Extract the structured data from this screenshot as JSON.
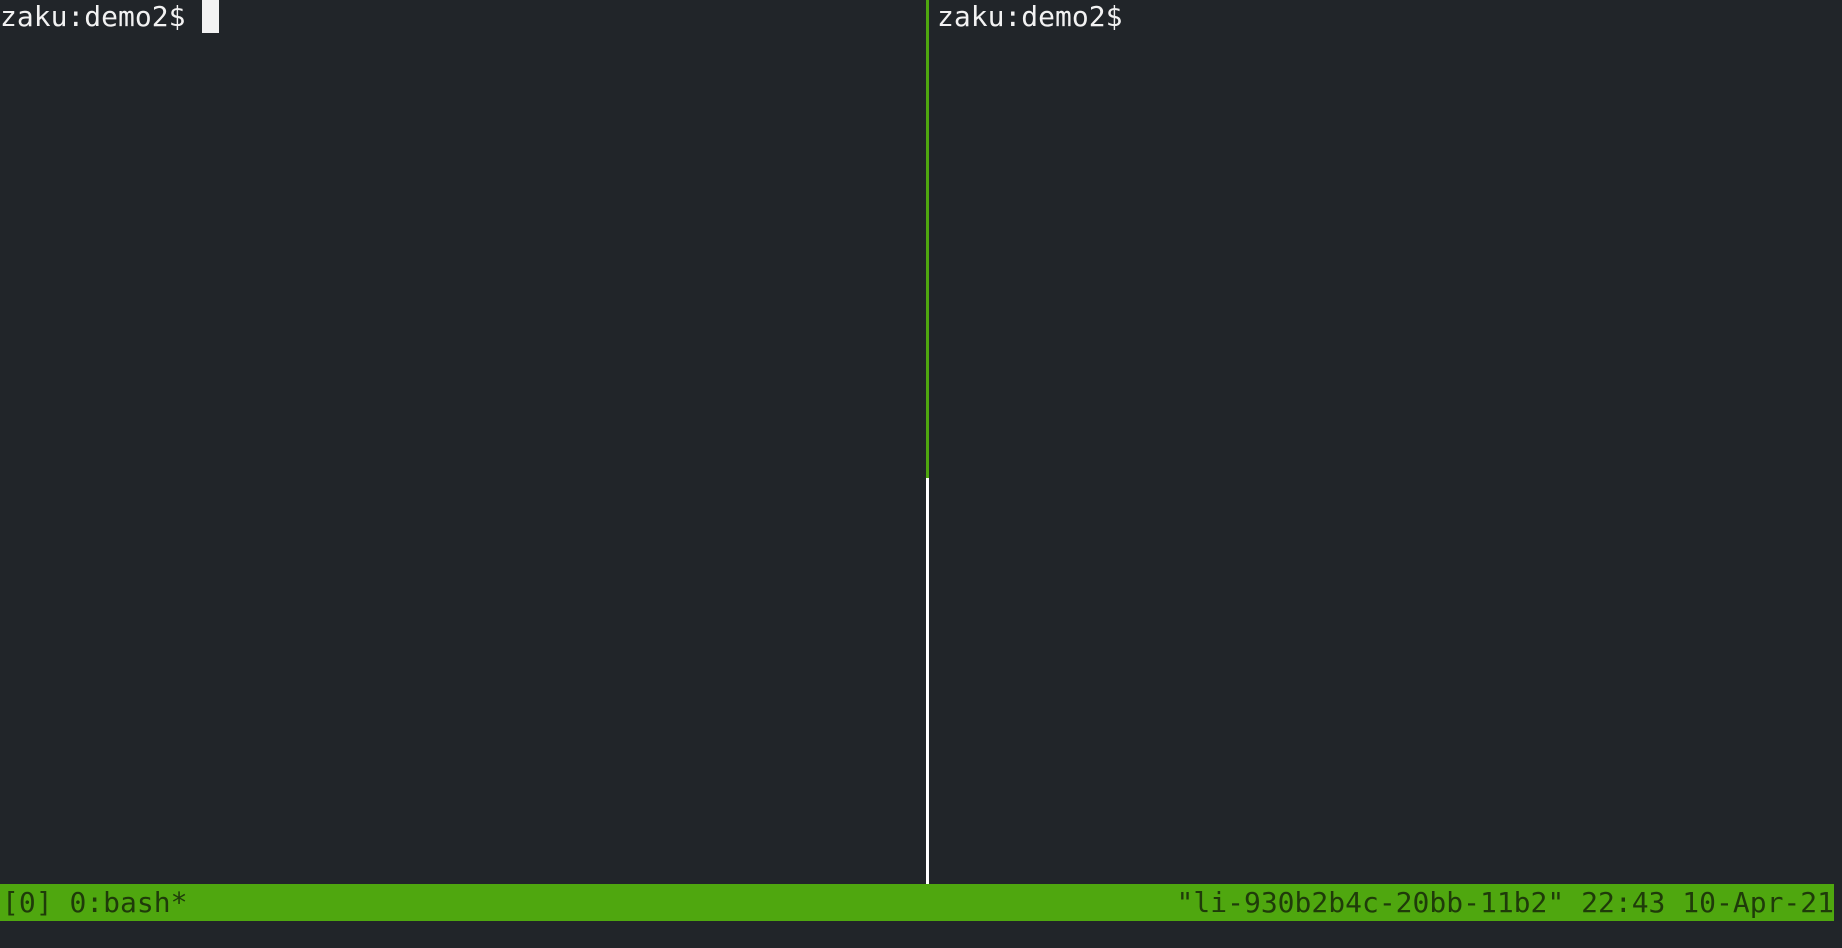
{
  "panes": {
    "left": {
      "prompt": "zaku:demo2$",
      "has_cursor": true
    },
    "right": {
      "prompt": "zaku:demo2$"
    }
  },
  "status_bar": {
    "session": "[0]",
    "window": "0:bash*",
    "hostname": "\"li-930b2b4c-20bb-11b2\"",
    "time": "22:43",
    "date": "10-Apr-21"
  },
  "colors": {
    "background": "#212529",
    "accent": "#4fa70f",
    "text": "#f2f2f2",
    "status_text": "#1f3b0a"
  }
}
